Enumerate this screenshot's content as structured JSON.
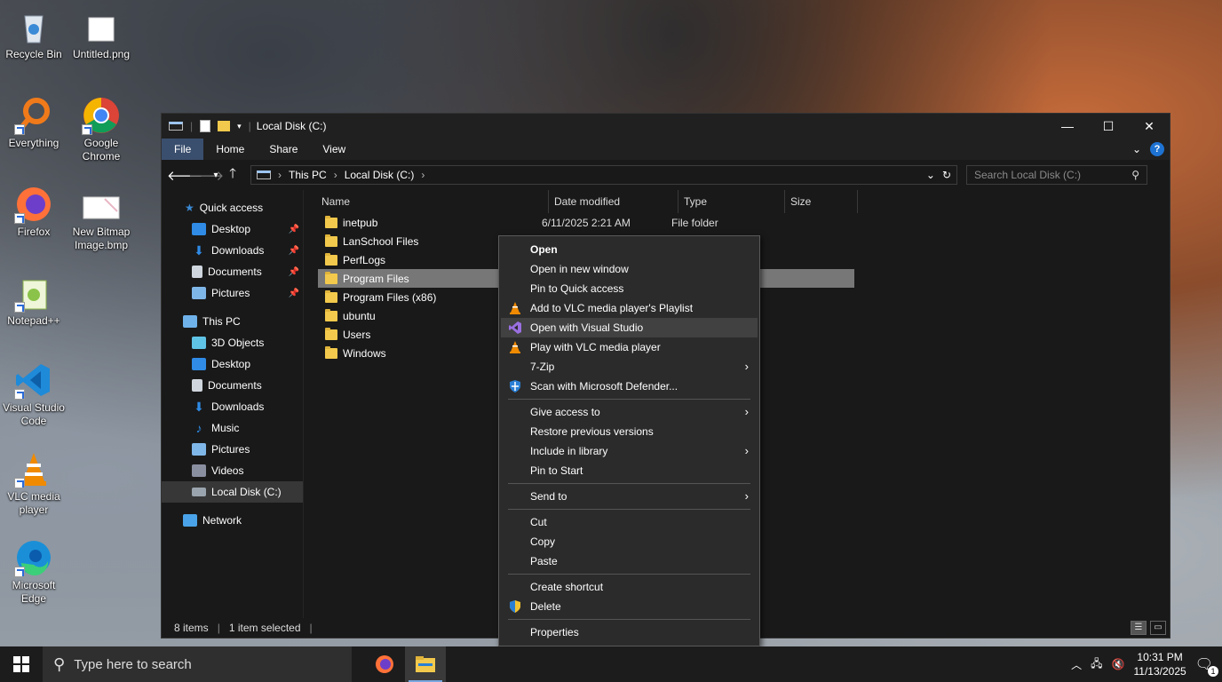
{
  "desktop": {
    "icons": [
      {
        "label": "Recycle Bin"
      },
      {
        "label": "Untitled.png"
      },
      {
        "label": "Everything"
      },
      {
        "label": "Google Chrome"
      },
      {
        "label": "Firefox"
      },
      {
        "label": "New Bitmap Image.bmp"
      },
      {
        "label": "Notepad++"
      },
      {
        "label": "Visual Studio Code"
      },
      {
        "label": "VLC media player"
      },
      {
        "label": "Microsoft Edge"
      }
    ]
  },
  "window": {
    "title": "Local Disk (C:)",
    "ribbon_tabs": [
      "File",
      "Home",
      "Share",
      "View"
    ],
    "breadcrumb": [
      "This PC",
      "Local Disk (C:)"
    ],
    "search_placeholder": "Search Local Disk (C:)",
    "nav": {
      "quick_access": "Quick access",
      "quick_items": [
        "Desktop",
        "Downloads",
        "Documents",
        "Pictures"
      ],
      "this_pc": "This PC",
      "pc_items": [
        "3D Objects",
        "Desktop",
        "Documents",
        "Downloads",
        "Music",
        "Pictures",
        "Videos",
        "Local Disk (C:)"
      ],
      "network": "Network"
    },
    "columns": [
      "Name",
      "Date modified",
      "Type",
      "Size"
    ],
    "files": [
      {
        "name": "inetpub",
        "date": "6/11/2025 2:21 AM",
        "type": "File folder"
      },
      {
        "name": "LanSchool Files",
        "date": "",
        "type": ""
      },
      {
        "name": "PerfLogs",
        "date": "",
        "type": ""
      },
      {
        "name": "Program Files",
        "date": "",
        "type": ""
      },
      {
        "name": "Program Files (x86)",
        "date": "",
        "type": ""
      },
      {
        "name": "ubuntu",
        "date": "",
        "type": ""
      },
      {
        "name": "Users",
        "date": "",
        "type": ""
      },
      {
        "name": "Windows",
        "date": "",
        "type": ""
      }
    ],
    "status": {
      "items": "8 items",
      "selected": "1 item selected"
    }
  },
  "context_menu": {
    "items": [
      "Open",
      "Open in new window",
      "Pin to Quick access",
      "Add to VLC media player's Playlist",
      "Open with Visual Studio",
      "Play with VLC media player",
      "7-Zip",
      "Scan with Microsoft Defender...",
      "Give access to",
      "Restore previous versions",
      "Include in library",
      "Pin to Start",
      "Send to",
      "Cut",
      "Copy",
      "Paste",
      "Create shortcut",
      "Delete",
      "Properties"
    ]
  },
  "taskbar": {
    "search_placeholder": "Type here to search",
    "time": "10:31 PM",
    "date": "11/13/2025",
    "notification_count": "1"
  }
}
